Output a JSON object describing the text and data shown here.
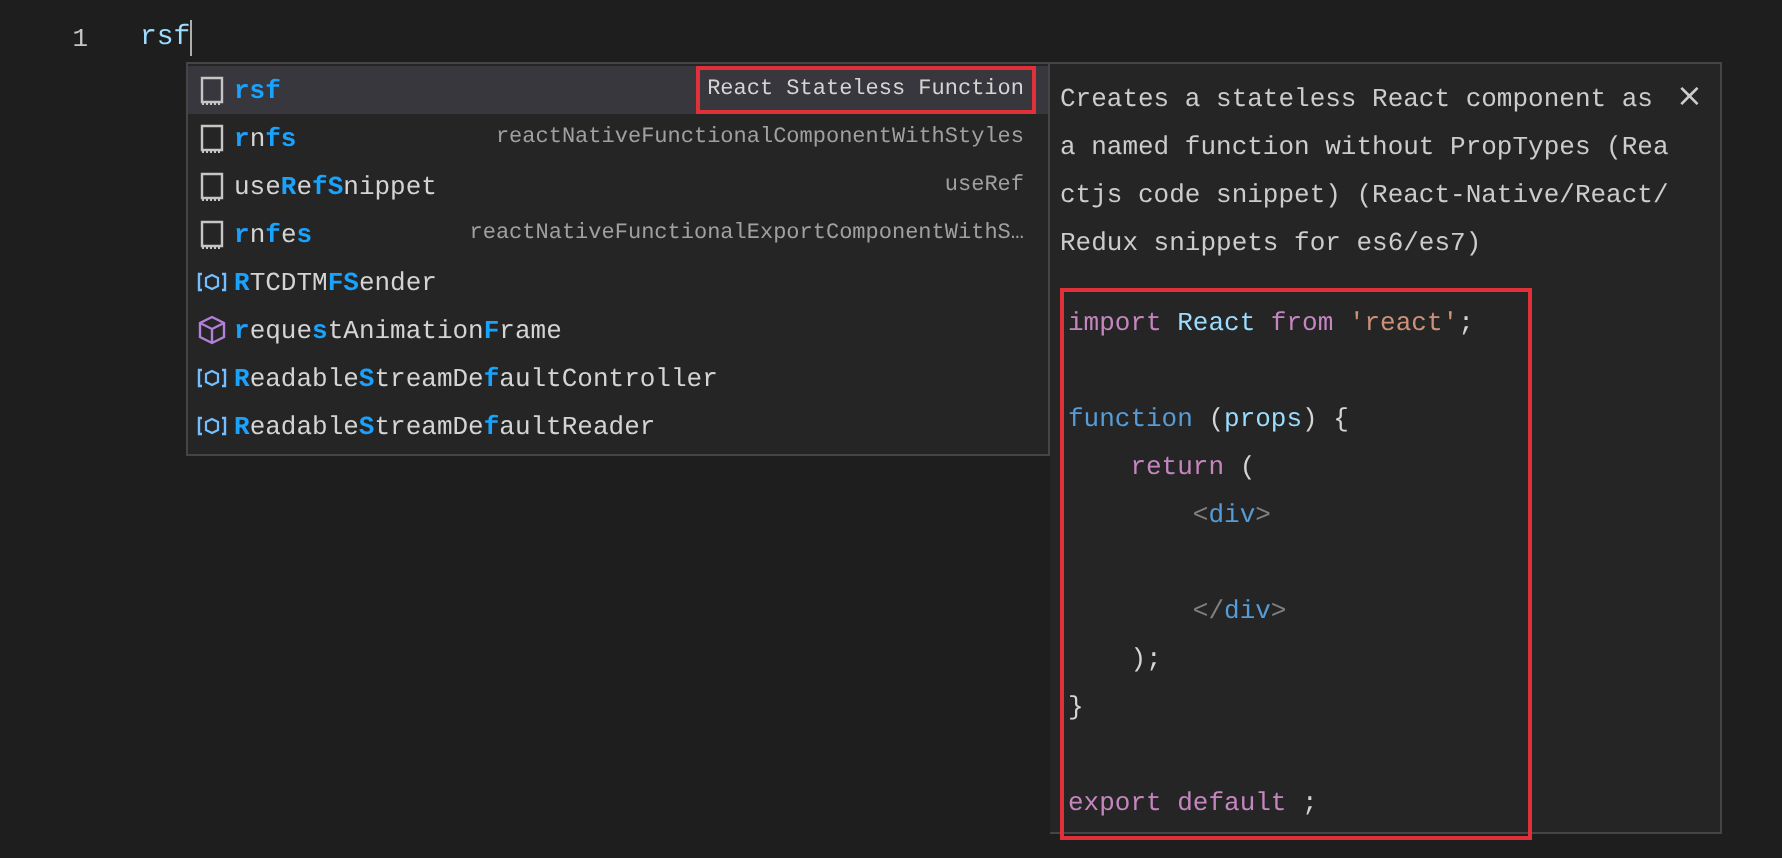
{
  "editor": {
    "line_number": "1",
    "typed_text": "rsf"
  },
  "suggestions": [
    {
      "kind": "snippet",
      "selected": true,
      "annotated": true,
      "label_parts": [
        {
          "text": "rsf",
          "match": true
        }
      ],
      "detail": "React Stateless Function"
    },
    {
      "kind": "snippet",
      "selected": false,
      "annotated": false,
      "label_parts": [
        {
          "text": "r",
          "match": true
        },
        {
          "text": "n",
          "match": false
        },
        {
          "text": "fs",
          "match": true
        }
      ],
      "detail": "reactNativeFunctionalComponentWithStyles"
    },
    {
      "kind": "snippet",
      "selected": false,
      "annotated": false,
      "label_parts": [
        {
          "text": "use",
          "match": false
        },
        {
          "text": "R",
          "match": true
        },
        {
          "text": "e",
          "match": false
        },
        {
          "text": "fS",
          "match": true
        },
        {
          "text": "nippet",
          "match": false
        }
      ],
      "detail": "useRef"
    },
    {
      "kind": "snippet",
      "selected": false,
      "annotated": false,
      "label_parts": [
        {
          "text": "r",
          "match": true
        },
        {
          "text": "n",
          "match": false
        },
        {
          "text": "f",
          "match": true
        },
        {
          "text": "e",
          "match": false
        },
        {
          "text": "s",
          "match": true
        }
      ],
      "detail": "reactNativeFunctionalExportComponentWithS…"
    },
    {
      "kind": "variable",
      "selected": false,
      "label_parts": [
        {
          "text": "R",
          "match": true
        },
        {
          "text": "TCDTM",
          "match": false
        },
        {
          "text": "FS",
          "match": true
        },
        {
          "text": "ender",
          "match": false
        }
      ]
    },
    {
      "kind": "method",
      "selected": false,
      "label_parts": [
        {
          "text": "r",
          "match": true
        },
        {
          "text": "eque",
          "match": false
        },
        {
          "text": "s",
          "match": true
        },
        {
          "text": "tAnimation",
          "match": false
        },
        {
          "text": "F",
          "match": true
        },
        {
          "text": "rame",
          "match": false
        }
      ]
    },
    {
      "kind": "variable",
      "selected": false,
      "label_parts": [
        {
          "text": "R",
          "match": true
        },
        {
          "text": "eadable",
          "match": false
        },
        {
          "text": "S",
          "match": true
        },
        {
          "text": "treamDe",
          "match": false
        },
        {
          "text": "f",
          "match": true
        },
        {
          "text": "aultController",
          "match": false
        }
      ]
    },
    {
      "kind": "variable",
      "selected": false,
      "label_parts": [
        {
          "text": "R",
          "match": true
        },
        {
          "text": "eadable",
          "match": false
        },
        {
          "text": "S",
          "match": true
        },
        {
          "text": "treamDe",
          "match": false
        },
        {
          "text": "f",
          "match": true
        },
        {
          "text": "aultReader",
          "match": false
        }
      ]
    }
  ],
  "details": {
    "close": "×",
    "description": "Creates a stateless React component as a named function without PropTypes (Reactjs code snippet) (React-Native/React/Redux snippets for es6/es7)",
    "code_annotated": true,
    "code_lines": [
      {
        "kind": "code",
        "tokens": [
          {
            "text": "import",
            "kind": "keyword"
          },
          {
            "text": " React",
            "kind": "variable"
          },
          {
            "text": " from",
            "kind": "keyword"
          },
          {
            "text": " 'react'",
            "kind": "string"
          },
          {
            "text": ";",
            "kind": "plain"
          }
        ]
      },
      {
        "kind": "blank"
      },
      {
        "kind": "code",
        "tokens": [
          {
            "text": "function",
            "kind": "storage"
          },
          {
            "text": " (",
            "kind": "plain"
          },
          {
            "text": "props",
            "kind": "variable"
          },
          {
            "text": ") {",
            "kind": "plain"
          }
        ]
      },
      {
        "kind": "code",
        "tokens": [
          {
            "text": "    return",
            "kind": "keyword"
          },
          {
            "text": " (",
            "kind": "plain"
          }
        ]
      },
      {
        "kind": "code",
        "tokens": [
          {
            "text": "        <",
            "kind": "bracket"
          },
          {
            "text": "div",
            "kind": "tag"
          },
          {
            "text": ">",
            "kind": "bracket"
          }
        ]
      },
      {
        "kind": "blank"
      },
      {
        "kind": "code",
        "tokens": [
          {
            "text": "        </",
            "kind": "bracket"
          },
          {
            "text": "div",
            "kind": "tag"
          },
          {
            "text": ">",
            "kind": "bracket"
          }
        ]
      },
      {
        "kind": "code",
        "tokens": [
          {
            "text": "    );",
            "kind": "plain"
          }
        ]
      },
      {
        "kind": "code",
        "tokens": [
          {
            "text": "}",
            "kind": "plain"
          }
        ]
      },
      {
        "kind": "blank"
      },
      {
        "kind": "code",
        "tokens": [
          {
            "text": "export",
            "kind": "keyword"
          },
          {
            "text": " default",
            "kind": "keyword"
          },
          {
            "text": " ;",
            "kind": "plain"
          }
        ]
      }
    ]
  }
}
